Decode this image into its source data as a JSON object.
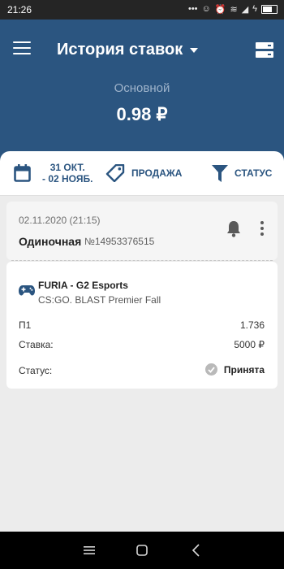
{
  "status_bar": {
    "time": "21:26",
    "icons": [
      "dots-icon",
      "face-icon",
      "alarm-icon",
      "wifi-icon",
      "signal-icon",
      "bolt-icon",
      "battery-icon"
    ]
  },
  "header": {
    "title": "История ставок",
    "account_label": "Основной",
    "balance": "0.98 ₽"
  },
  "filters": {
    "date_line1": "31 ОКТ.",
    "date_line2": "- 02 НОЯБ.",
    "sale": "ПРОДАЖА",
    "status": "СТАТУС"
  },
  "bet": {
    "datetime": "02.11.2020 (21:15)",
    "type": "Одиночная",
    "number": "№14953376515",
    "event": "FURIA - G2 Esports",
    "league": "CS:GO. BLAST Premier Fall",
    "outcome_label": "П1",
    "coefficient": "1.736",
    "stake_label": "Ставка:",
    "stake_value": "5000 ₽",
    "status_label": "Статус:",
    "status_value": "Принята"
  },
  "colors": {
    "primary": "#2b5580",
    "background": "#ececec"
  }
}
